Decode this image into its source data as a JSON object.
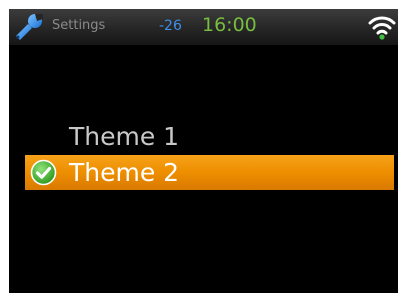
{
  "status_bar": {
    "app_icon": "wrench-icon",
    "title": "Settings",
    "signal_value": "-26",
    "time": "16:00",
    "wifi_icon": "wifi-icon"
  },
  "theme_list": {
    "items": [
      {
        "label": "Theme 1",
        "selected": false
      },
      {
        "label": "Theme 2",
        "selected": true,
        "icon": "check-circle-icon"
      }
    ]
  },
  "colors": {
    "screen_background": "#000000",
    "status_title": "#8a8a8a",
    "signal_value": "#3e8fe8",
    "clock": "#77bd3e",
    "highlight": "#ee8e00",
    "item_text": "#c8c8c8",
    "selected_text": "#ffffff",
    "check_icon": "#43b02a"
  }
}
